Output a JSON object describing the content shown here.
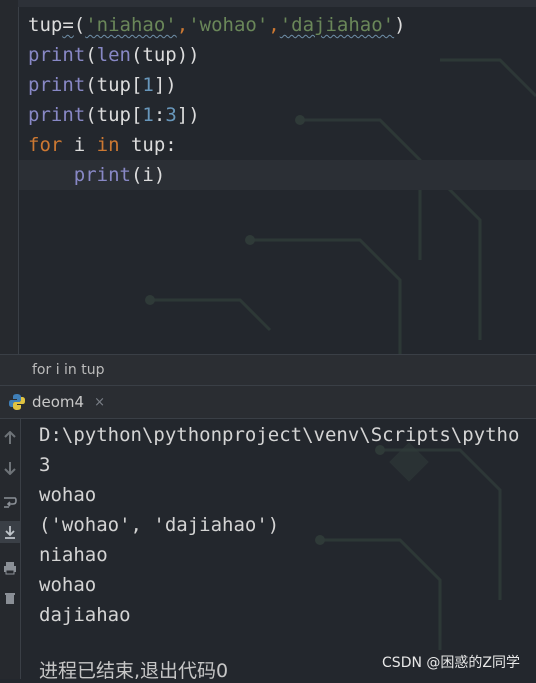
{
  "editor": {
    "lines": [
      {
        "parts": [
          {
            "t": "tup",
            "c": ""
          },
          {
            "t": "=",
            "c": "squig"
          },
          {
            "t": "(",
            "c": ""
          },
          {
            "t": "'niahao'",
            "c": "str squig"
          },
          {
            "t": ",",
            "c": "comma"
          },
          {
            "t": "'wohao'",
            "c": "str"
          },
          {
            "t": ",",
            "c": "comma"
          },
          {
            "t": "'dajiahao'",
            "c": "str squig"
          },
          {
            "t": ")",
            "c": ""
          }
        ]
      },
      {
        "parts": [
          {
            "t": "print",
            "c": "bi"
          },
          {
            "t": "(",
            "c": ""
          },
          {
            "t": "len",
            "c": "bi"
          },
          {
            "t": "(tup))",
            "c": ""
          }
        ]
      },
      {
        "parts": [
          {
            "t": "print",
            "c": "bi"
          },
          {
            "t": "(tup[",
            "c": ""
          },
          {
            "t": "1",
            "c": "num"
          },
          {
            "t": "])",
            "c": ""
          }
        ]
      },
      {
        "parts": [
          {
            "t": "print",
            "c": "bi"
          },
          {
            "t": "(tup[",
            "c": ""
          },
          {
            "t": "1",
            "c": "num"
          },
          {
            "t": ":",
            "c": ""
          },
          {
            "t": "3",
            "c": "num"
          },
          {
            "t": "])",
            "c": ""
          }
        ]
      },
      {
        "parts": [
          {
            "t": "for",
            "c": "kw"
          },
          {
            "t": " i ",
            "c": ""
          },
          {
            "t": "in",
            "c": "kw"
          },
          {
            "t": " tup:",
            "c": ""
          }
        ]
      },
      {
        "parts": [
          {
            "t": "    ",
            "c": ""
          },
          {
            "t": "print",
            "c": "bi"
          },
          {
            "t": "(i)",
            "c": ""
          }
        ]
      }
    ]
  },
  "breadcrumb": {
    "text": "for i in tup"
  },
  "run_tab": {
    "label": "deom4",
    "close": "×"
  },
  "console": {
    "lines": [
      "D:\\python\\pythonproject\\venv\\Scripts\\pytho",
      "3",
      "wohao",
      "('wohao', 'dajiahao')",
      "niahao",
      "wohao",
      "dajiahao"
    ],
    "exit_message": "进程已结束,退出代码0"
  },
  "watermark": "CSDN @困惑的Z同学",
  "colors": {
    "background": "#23272d",
    "keyword": "#cc7832",
    "builtin": "#8888c6",
    "string": "#6a8759",
    "number": "#6897bb"
  }
}
